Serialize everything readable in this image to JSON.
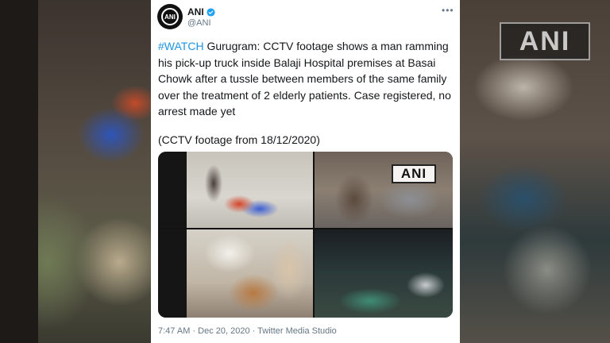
{
  "tweet": {
    "display_name": "ANI",
    "handle": "@ANI",
    "avatar_text": "ANI",
    "more_label": "•••",
    "hashtag": "#WATCH",
    "body": " Gurugram: CCTV footage shows a man ramming his pick-up truck inside Balaji Hospital premises at Basai Chowk after a tussle between members of the same family over the treatment of 2 elderly patients. Case registered, no arrest made yet",
    "sub_text": "(CCTV footage from 18/12/2020)",
    "media": {
      "watermark": "ANI",
      "panels": [
        "cctv-panel-1",
        "cctv-panel-2",
        "cctv-panel-3",
        "cctv-panel-4"
      ]
    },
    "footer": "7:47 AM · Dec 20, 2020 · Twitter Media Studio"
  },
  "background": {
    "watermark": "ANI"
  },
  "colors": {
    "link": "#1b95e0",
    "verified": "#1da1f2",
    "muted": "#657786",
    "text": "#14171a"
  },
  "icons": [
    "verified-badge-icon",
    "more-options-icon"
  ]
}
